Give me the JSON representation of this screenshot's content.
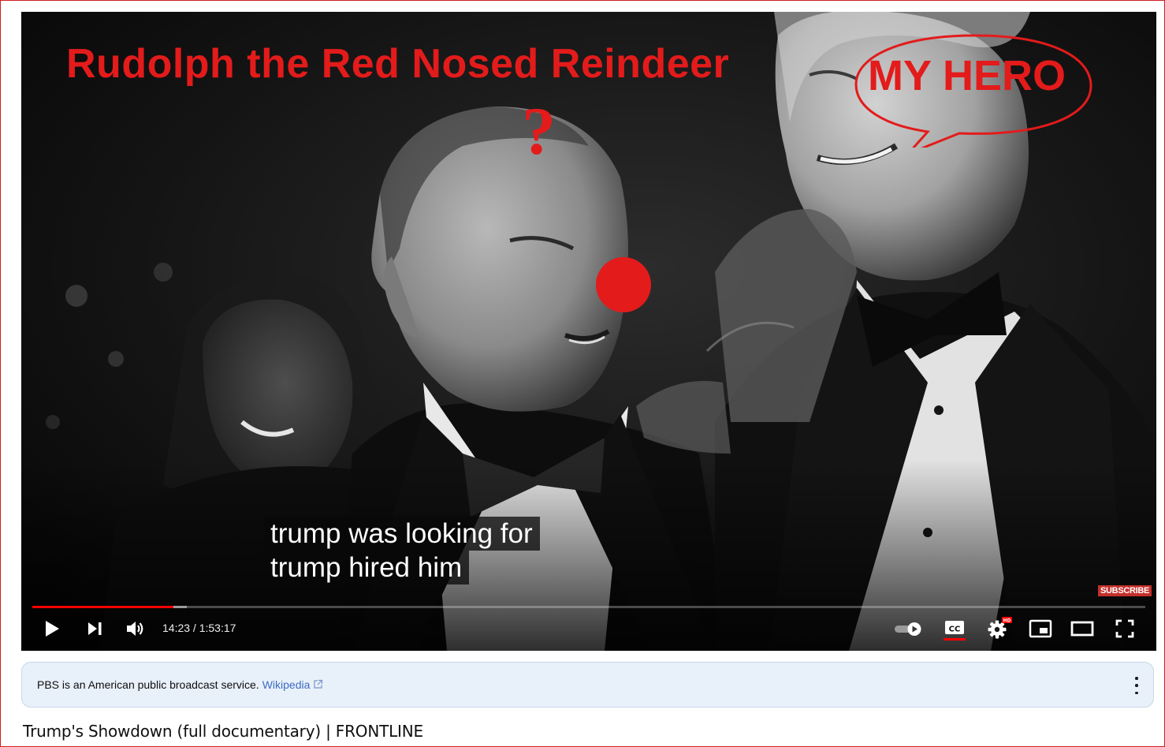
{
  "overlay": {
    "title": "Rudolph the Red Nosed Reindeer",
    "question_mark": "?",
    "speech_bubble": "MY HERO",
    "accent_color": "#e31b1b"
  },
  "captions": {
    "line1": "trump was looking for",
    "line2": "trump hired him"
  },
  "player": {
    "subscribe_badge": "SUBSCRIBE",
    "current_time": "14:23",
    "duration": "1:53:17",
    "time_display": "14:23 / 1:53:17",
    "progress_fraction": 0.127,
    "buffered_fraction": 0.139,
    "progress_color": "#ff0000",
    "hd_badge": "HD",
    "controls": [
      "play-icon",
      "next-icon",
      "volume-icon",
      "autoplay-toggle-icon",
      "closed-captions-icon",
      "settings-gear-icon",
      "miniplayer-icon",
      "theater-mode-icon",
      "fullscreen-icon"
    ]
  },
  "info_panel": {
    "text": "PBS is an American public broadcast service.",
    "link_label": "Wikipedia",
    "link_icon": "external-link-icon",
    "menu_icon": "more-vertical-icon"
  },
  "video_title": "Trump's Showdown (full documentary) | FRONTLINE"
}
